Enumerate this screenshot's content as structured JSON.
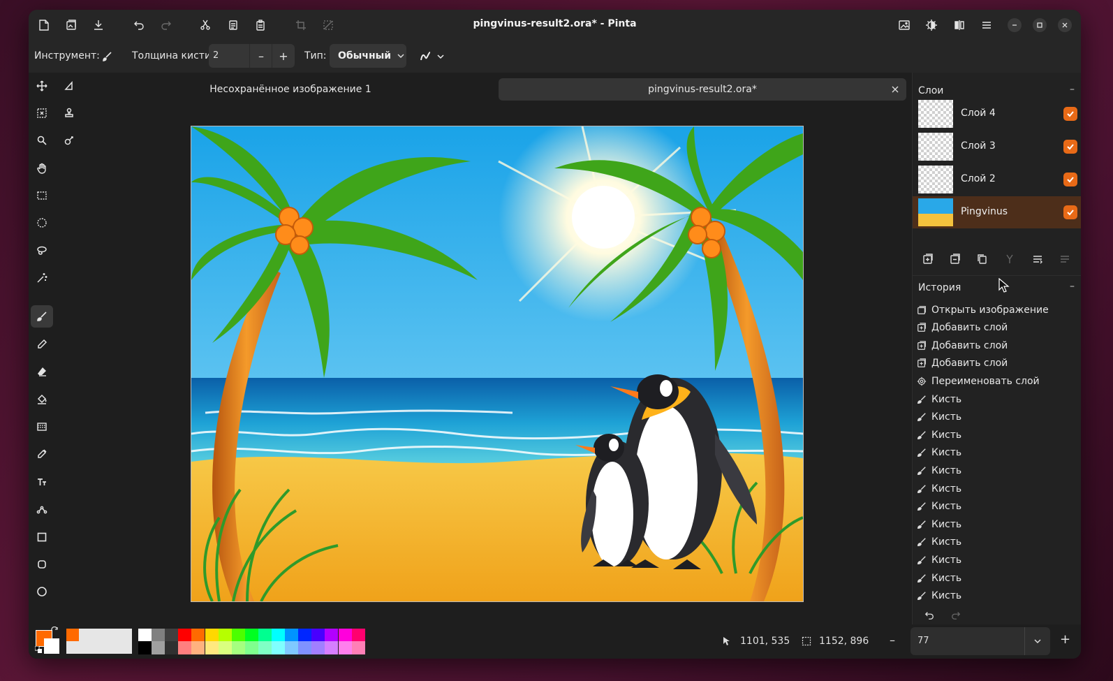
{
  "window": {
    "title": "pingvinus-result2.ora* - Pinta"
  },
  "titlebar": {
    "left_buttons": [
      "new-image-icon",
      "open-image-icon",
      "save-icon",
      "undo-icon",
      "redo-icon",
      "cut-icon",
      "copy-icon",
      "paste-icon",
      "crop-icon",
      "deselect-icon"
    ],
    "right_buttons": [
      "adjustments-icon",
      "effects-icon",
      "image-menu-icon",
      "main-menu-icon"
    ]
  },
  "toolbar": {
    "tool_label": "Инструмент:",
    "brush_width_label": "Толщина кисти:",
    "brush_width_value": "2",
    "type_label": "Тип:",
    "type_value": "Обычный"
  },
  "tools": [
    "move-selected-icon",
    "select-icon",
    "zoom-icon",
    "pan-icon",
    "rectangle-select-icon",
    "ellipse-select-icon",
    "lasso-select-icon",
    "magic-wand-icon",
    "paintbrush-icon",
    "pencil-icon",
    "eraser-icon",
    "paint-bucket-icon",
    "gradient-icon",
    "color-picker-icon",
    "text-icon",
    "line-curve-icon",
    "rectangle-icon",
    "rounded-rectangle-icon",
    "ellipse-icon",
    "freeform-shape-icon",
    "clone-stamp-icon",
    "recolor-icon"
  ],
  "tabs": [
    {
      "label": "Несохранённое изображение 1"
    },
    {
      "label": "pingvinus-result2.ora*"
    }
  ],
  "layers_panel": {
    "title": "Слои",
    "collapse": "–",
    "layers": [
      {
        "name": "Слой 4",
        "visible": true,
        "selected": false
      },
      {
        "name": "Слой 3",
        "visible": true,
        "selected": false
      },
      {
        "name": "Слой 2",
        "visible": true,
        "selected": false
      },
      {
        "name": "Pingvinus",
        "visible": true,
        "selected": true
      }
    ]
  },
  "history_panel": {
    "title": "История",
    "collapse": "–",
    "items": [
      {
        "label": "Открыть изображение",
        "icon": "open-image-icon"
      },
      {
        "label": "Добавить слой",
        "icon": "add-layer-icon"
      },
      {
        "label": "Добавить слой",
        "icon": "add-layer-icon"
      },
      {
        "label": "Добавить слой",
        "icon": "add-layer-icon"
      },
      {
        "label": "Переименовать слой",
        "icon": "layer-properties-icon"
      },
      {
        "label": "Кисть",
        "icon": "paintbrush-icon"
      },
      {
        "label": "Кисть",
        "icon": "paintbrush-icon"
      },
      {
        "label": "Кисть",
        "icon": "paintbrush-icon"
      },
      {
        "label": "Кисть",
        "icon": "paintbrush-icon"
      },
      {
        "label": "Кисть",
        "icon": "paintbrush-icon"
      },
      {
        "label": "Кисть",
        "icon": "paintbrush-icon"
      },
      {
        "label": "Кисть",
        "icon": "paintbrush-icon"
      },
      {
        "label": "Кисть",
        "icon": "paintbrush-icon"
      },
      {
        "label": "Кисть",
        "icon": "paintbrush-icon"
      },
      {
        "label": "Кисть",
        "icon": "paintbrush-icon"
      },
      {
        "label": "Кисть",
        "icon": "paintbrush-icon"
      },
      {
        "label": "Кисть",
        "icon": "paintbrush-icon"
      }
    ]
  },
  "status": {
    "cursor_position": "1101, 535",
    "selection_size": "1152, 896",
    "zoom": "77"
  },
  "colors": {
    "primary": "#ff6a00",
    "secondary": "#ffffff",
    "accent": "#e86a17",
    "palette_top": [
      "#ffffff",
      "#808080",
      "#404040",
      "#ff0000",
      "#ff6a00",
      "#ffd800",
      "#b6ff00",
      "#4cff00",
      "#00ff21",
      "#00ff90",
      "#00ffff",
      "#0094ff",
      "#0026ff",
      "#4800ff",
      "#b200ff",
      "#ff00dc",
      "#ff006e"
    ],
    "palette_bottom": [
      "#000000",
      "#a0a0a0",
      "#303030",
      "#ff7f7f",
      "#ffb27f",
      "#ffe97f",
      "#daff7f",
      "#a5ff7f",
      "#7fff8e",
      "#7fffc5",
      "#7fffff",
      "#7fc9ff",
      "#7f92ff",
      "#a17fff",
      "#d67fff",
      "#ff7fed",
      "#ff7fb6"
    ]
  }
}
